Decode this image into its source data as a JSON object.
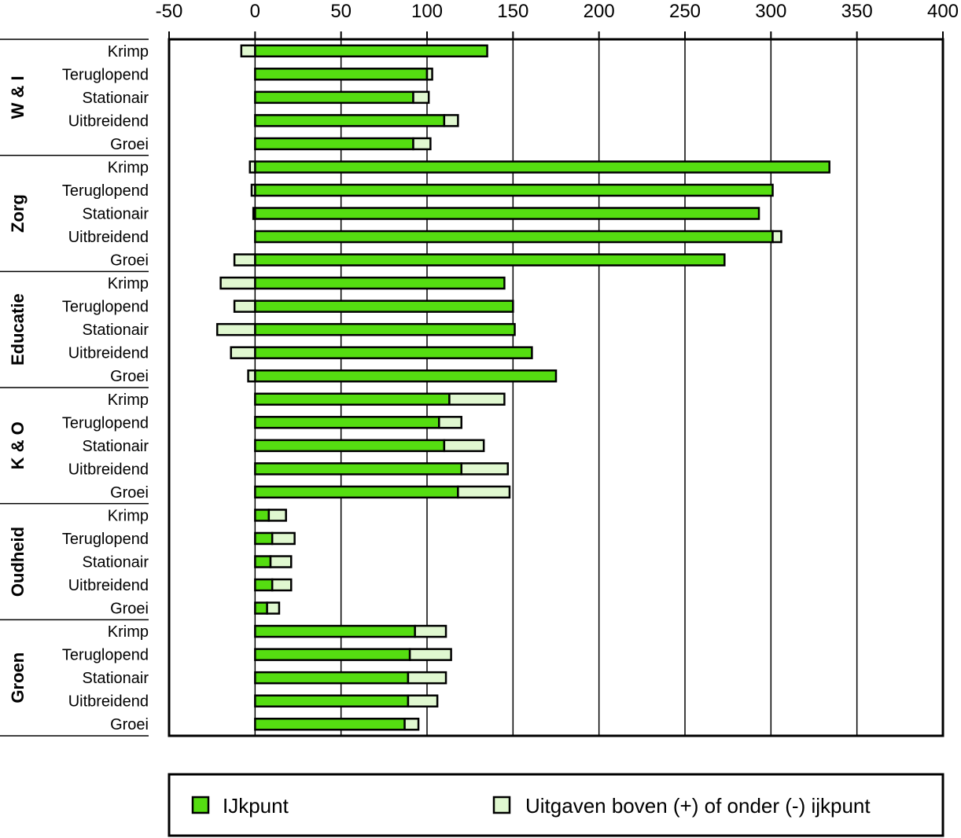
{
  "chart_data": {
    "type": "bar",
    "orientation": "horizontal",
    "stacked": true,
    "title": "",
    "xlabel": "",
    "ylabel": "",
    "xlim": [
      -50,
      400
    ],
    "x_ticks": [
      "-50",
      "0",
      "50",
      "100",
      "150",
      "200",
      "250",
      "300",
      "350",
      "400"
    ],
    "grid": "vertical",
    "legend_position": "bottom",
    "groups": [
      "W & I",
      "Zorg",
      "Educatie",
      "K & O",
      "Oudheid",
      "Groen"
    ],
    "categories": [
      "Krimp",
      "Teruglopend",
      "Stationair",
      "Uitbreidend",
      "Groei"
    ],
    "series": [
      {
        "name": "IJkpunt",
        "color": "#55dd11",
        "values": [
          [
            135,
            100,
            92,
            110,
            92
          ],
          [
            334,
            301,
            293,
            301,
            273
          ],
          [
            145,
            150,
            151,
            161,
            175
          ],
          [
            113,
            107,
            110,
            120,
            118
          ],
          [
            8,
            10,
            9,
            10,
            7
          ],
          [
            93,
            90,
            89,
            89,
            87
          ]
        ]
      },
      {
        "name": "Uitgaven boven (+) of onder (-) ijkpunt",
        "color": "#e0f8d0",
        "values": [
          [
            -8,
            3,
            9,
            8,
            10
          ],
          [
            -3,
            -2,
            -1,
            5,
            -12
          ],
          [
            -20,
            -12,
            -22,
            -14,
            -4
          ],
          [
            32,
            13,
            23,
            27,
            30
          ],
          [
            10,
            13,
            12,
            11,
            7
          ],
          [
            18,
            24,
            22,
            17,
            8
          ]
        ]
      }
    ]
  }
}
